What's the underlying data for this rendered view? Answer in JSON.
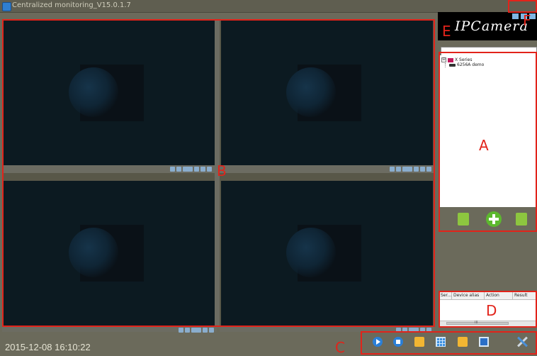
{
  "window": {
    "title": "Centralized monitoring_V15.0.1.7",
    "controls": [
      "restore-icon",
      "minimize-icon",
      "maximize-icon"
    ]
  },
  "logo": {
    "text": "IPCamera"
  },
  "video_panes": [
    {
      "id": "pane-1",
      "controls": [
        "pencil-icon",
        "volume-icon",
        "speak-icon",
        "snapshot-icon",
        "record-icon",
        "settings-icon",
        "ptz-icon"
      ]
    },
    {
      "id": "pane-2",
      "controls": [
        "pencil-icon",
        "volume-icon",
        "speak-icon",
        "snapshot-icon",
        "record-icon",
        "settings-icon",
        "ptz-icon"
      ]
    },
    {
      "id": "pane-3",
      "controls": [
        "pencil-icon",
        "volume-icon",
        "speak-icon",
        "snapshot-icon",
        "record-icon",
        "settings-icon",
        "ptz-icon"
      ]
    },
    {
      "id": "pane-4",
      "controls": [
        "pencil-icon",
        "volume-icon",
        "speak-icon",
        "snapshot-icon",
        "record-icon",
        "settings-icon",
        "ptz-icon"
      ]
    }
  ],
  "device_tree": {
    "search_value": "",
    "group": {
      "label": "X Series",
      "expander": "⊟"
    },
    "devices": [
      {
        "label": "6256A demo"
      }
    ]
  },
  "tree_toolbar": [
    "edit-device-icon",
    "add-device-icon",
    "delete-device-icon"
  ],
  "log_table": {
    "columns": [
      "Ser...",
      "Device alias",
      "Action",
      "Result"
    ],
    "rows": [],
    "scroll_label": "III"
  },
  "status": {
    "datetime": "2015-12-08 16:10:22"
  },
  "bottom_toolbar": [
    "play-all-icon",
    "stop-all-icon",
    "open-folder-icon",
    "layout-grid-icon",
    "record-folder-icon",
    "fullscreen-monitor-icon",
    "tools-settings-icon"
  ],
  "annotations": {
    "A": "A",
    "B": "B",
    "C": "C",
    "D": "D",
    "E": "E",
    "F": "F",
    "color": "#e2231a"
  }
}
